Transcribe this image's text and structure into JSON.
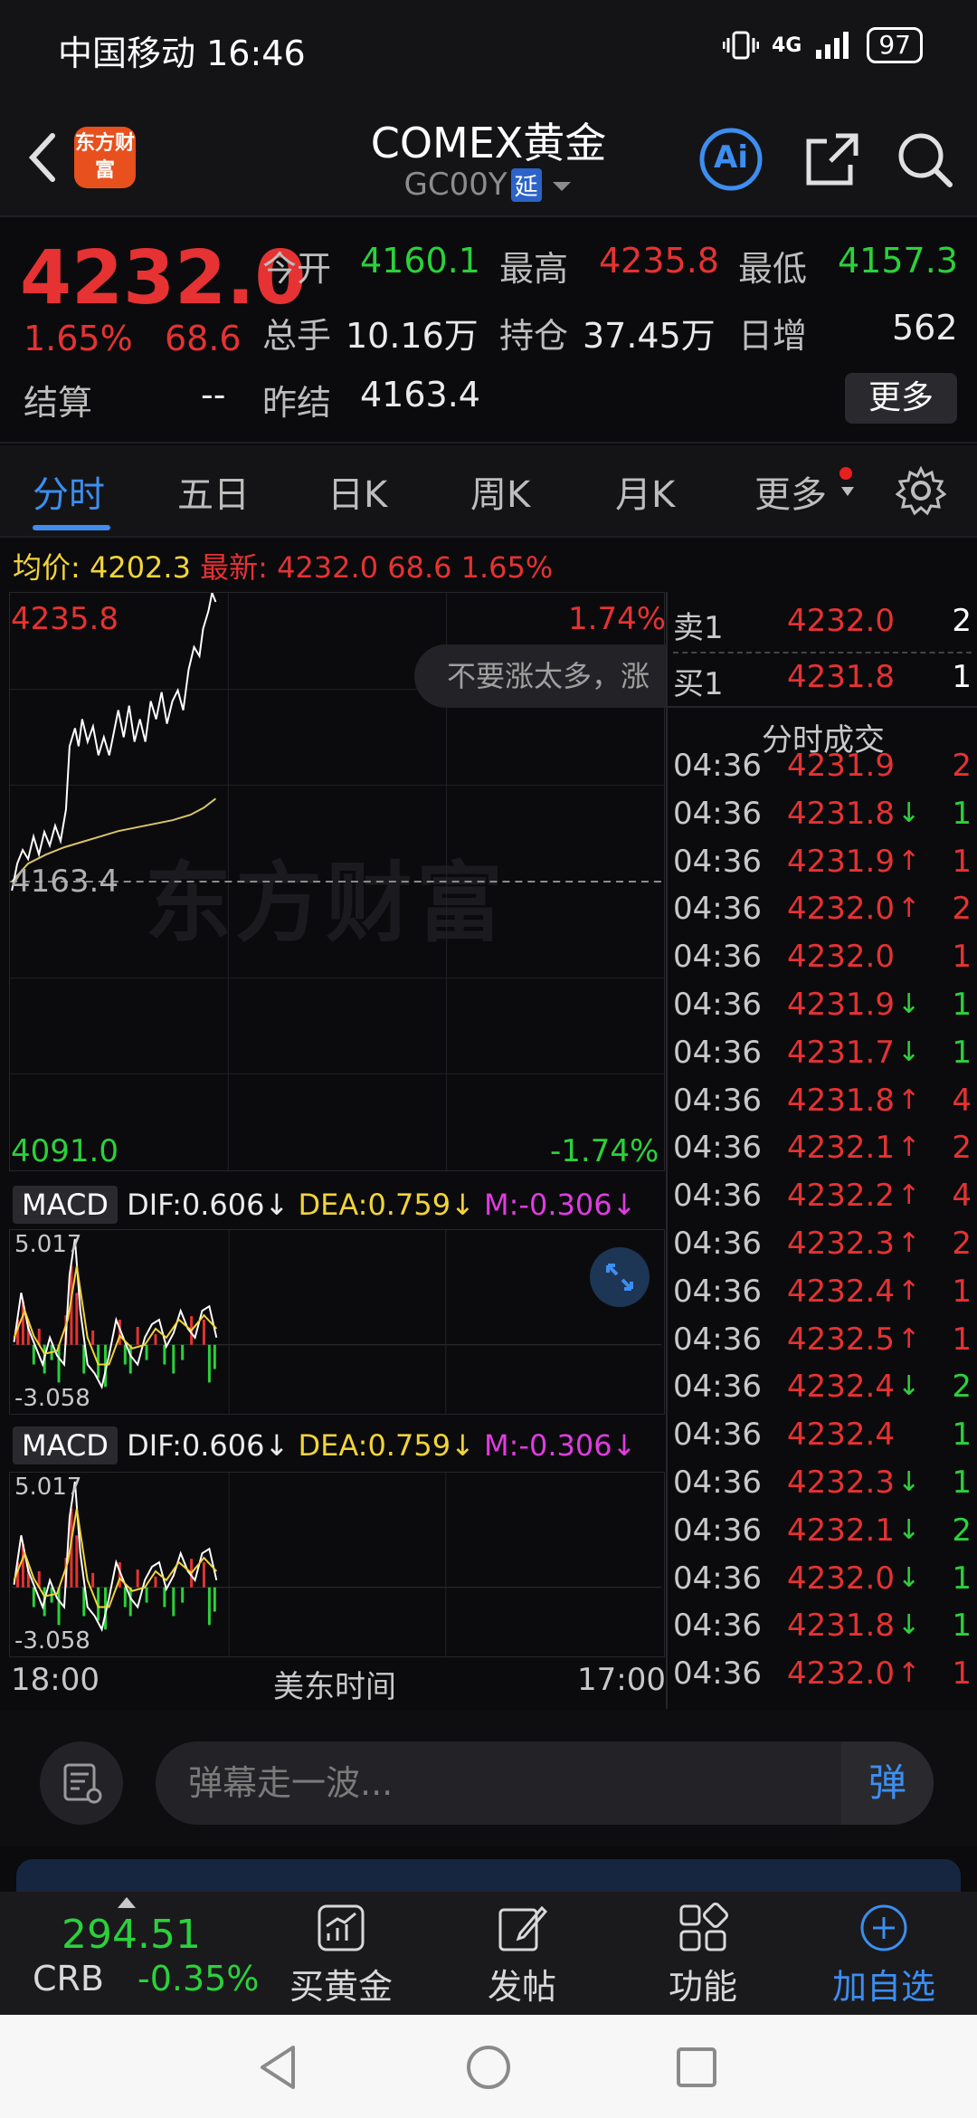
{
  "status_bar": {
    "carrier": "中国移动",
    "time": "16:46",
    "network": "4G",
    "battery": "97"
  },
  "header": {
    "title": "COMEX黄金",
    "code": "GC00Y",
    "delay_tag": "延",
    "logo_text": "东方财富",
    "ai_label": "Ai"
  },
  "quote": {
    "price": "4232.0",
    "change_pct": "1.65%",
    "change": "68.6",
    "open_label": "今开",
    "open": "4160.1",
    "high_label": "最高",
    "high": "4235.8",
    "low_label": "最低",
    "low": "4157.3",
    "volume_label": "总手",
    "volume": "10.16万",
    "oi_label": "持仓",
    "oi": "37.45万",
    "daily_inc_label": "日增",
    "daily_inc": "562",
    "settle_label": "结算",
    "settle": "--",
    "prev_settle_label": "昨结",
    "prev_settle": "4163.4",
    "more_button": "更多"
  },
  "tabs": [
    "分时",
    "五日",
    "日K",
    "周K",
    "月K",
    "更多"
  ],
  "avg_line": {
    "avg_label": "均价:",
    "avg": "4202.3",
    "latest_label": "最新:",
    "latest": "4232.0",
    "change": "68.6",
    "change_pct": "1.65%"
  },
  "chart": {
    "top_price": "4235.8",
    "top_pct": "1.74%",
    "mid_price": "4163.4",
    "bottom_price": "4091.0",
    "bottom_pct": "-1.74%",
    "watermark": "东方财富",
    "danmu_text": "不要涨太多，涨",
    "x_start": "18:00",
    "x_mid": "美东时间",
    "x_end": "17:00",
    "colors": {
      "price_line": "#ffffff",
      "avg_line": "#d9c36b",
      "up": "#e63232",
      "down": "#2bd13b"
    }
  },
  "macd": [
    {
      "selector": "MACD",
      "dif": "DIF:0.606",
      "dea": "DEA:0.759",
      "m": "M:-0.306",
      "top": "5.017",
      "bottom": "-3.058"
    },
    {
      "selector": "MACD",
      "dif": "DIF:0.606",
      "dea": "DEA:0.759",
      "m": "M:-0.306",
      "top": "5.017",
      "bottom": "-3.058"
    }
  ],
  "order_book": {
    "sell_label": "卖1",
    "sell_price": "4232.0",
    "sell_vol": "2",
    "buy_label": "买1",
    "buy_price": "4231.8",
    "buy_vol": "1",
    "trades_title": "分时成交"
  },
  "trades": [
    {
      "time": "04:36",
      "price": "4231.9",
      "arrow": "",
      "vol": "2",
      "vol_color": "red"
    },
    {
      "time": "04:36",
      "price": "4231.8",
      "arrow": "↓",
      "vol": "1",
      "vol_color": "green"
    },
    {
      "time": "04:36",
      "price": "4231.9",
      "arrow": "↑",
      "vol": "1",
      "vol_color": "red"
    },
    {
      "time": "04:36",
      "price": "4232.0",
      "arrow": "↑",
      "vol": "2",
      "vol_color": "red"
    },
    {
      "time": "04:36",
      "price": "4232.0",
      "arrow": "",
      "vol": "1",
      "vol_color": "red"
    },
    {
      "time": "04:36",
      "price": "4231.9",
      "arrow": "↓",
      "vol": "1",
      "vol_color": "green"
    },
    {
      "time": "04:36",
      "price": "4231.7",
      "arrow": "↓",
      "vol": "1",
      "vol_color": "green"
    },
    {
      "time": "04:36",
      "price": "4231.8",
      "arrow": "↑",
      "vol": "4",
      "vol_color": "red"
    },
    {
      "time": "04:36",
      "price": "4232.1",
      "arrow": "↑",
      "vol": "2",
      "vol_color": "red"
    },
    {
      "time": "04:36",
      "price": "4232.2",
      "arrow": "↑",
      "vol": "4",
      "vol_color": "red"
    },
    {
      "time": "04:36",
      "price": "4232.3",
      "arrow": "↑",
      "vol": "2",
      "vol_color": "red"
    },
    {
      "time": "04:36",
      "price": "4232.4",
      "arrow": "↑",
      "vol": "1",
      "vol_color": "red"
    },
    {
      "time": "04:36",
      "price": "4232.5",
      "arrow": "↑",
      "vol": "1",
      "vol_color": "red"
    },
    {
      "time": "04:36",
      "price": "4232.4",
      "arrow": "↓",
      "vol": "2",
      "vol_color": "green"
    },
    {
      "time": "04:36",
      "price": "4232.4",
      "arrow": "",
      "vol": "1",
      "vol_color": "green"
    },
    {
      "time": "04:36",
      "price": "4232.3",
      "arrow": "↓",
      "vol": "1",
      "vol_color": "green"
    },
    {
      "time": "04:36",
      "price": "4232.1",
      "arrow": "↓",
      "vol": "2",
      "vol_color": "green"
    },
    {
      "time": "04:36",
      "price": "4232.0",
      "arrow": "↓",
      "vol": "1",
      "vol_color": "green"
    },
    {
      "time": "04:36",
      "price": "4231.8",
      "arrow": "↓",
      "vol": "1",
      "vol_color": "green"
    },
    {
      "time": "04:36",
      "price": "4232.0",
      "arrow": "↑",
      "vol": "1",
      "vol_color": "red"
    }
  ],
  "danmu_input": {
    "placeholder": "弹幕走一波...",
    "send_label": "弹"
  },
  "bottom_nav": {
    "index_value": "294.51",
    "index_name": "CRB",
    "index_change": "-0.35%",
    "items": [
      "买黄金",
      "发帖",
      "功能",
      "加自选"
    ]
  }
}
